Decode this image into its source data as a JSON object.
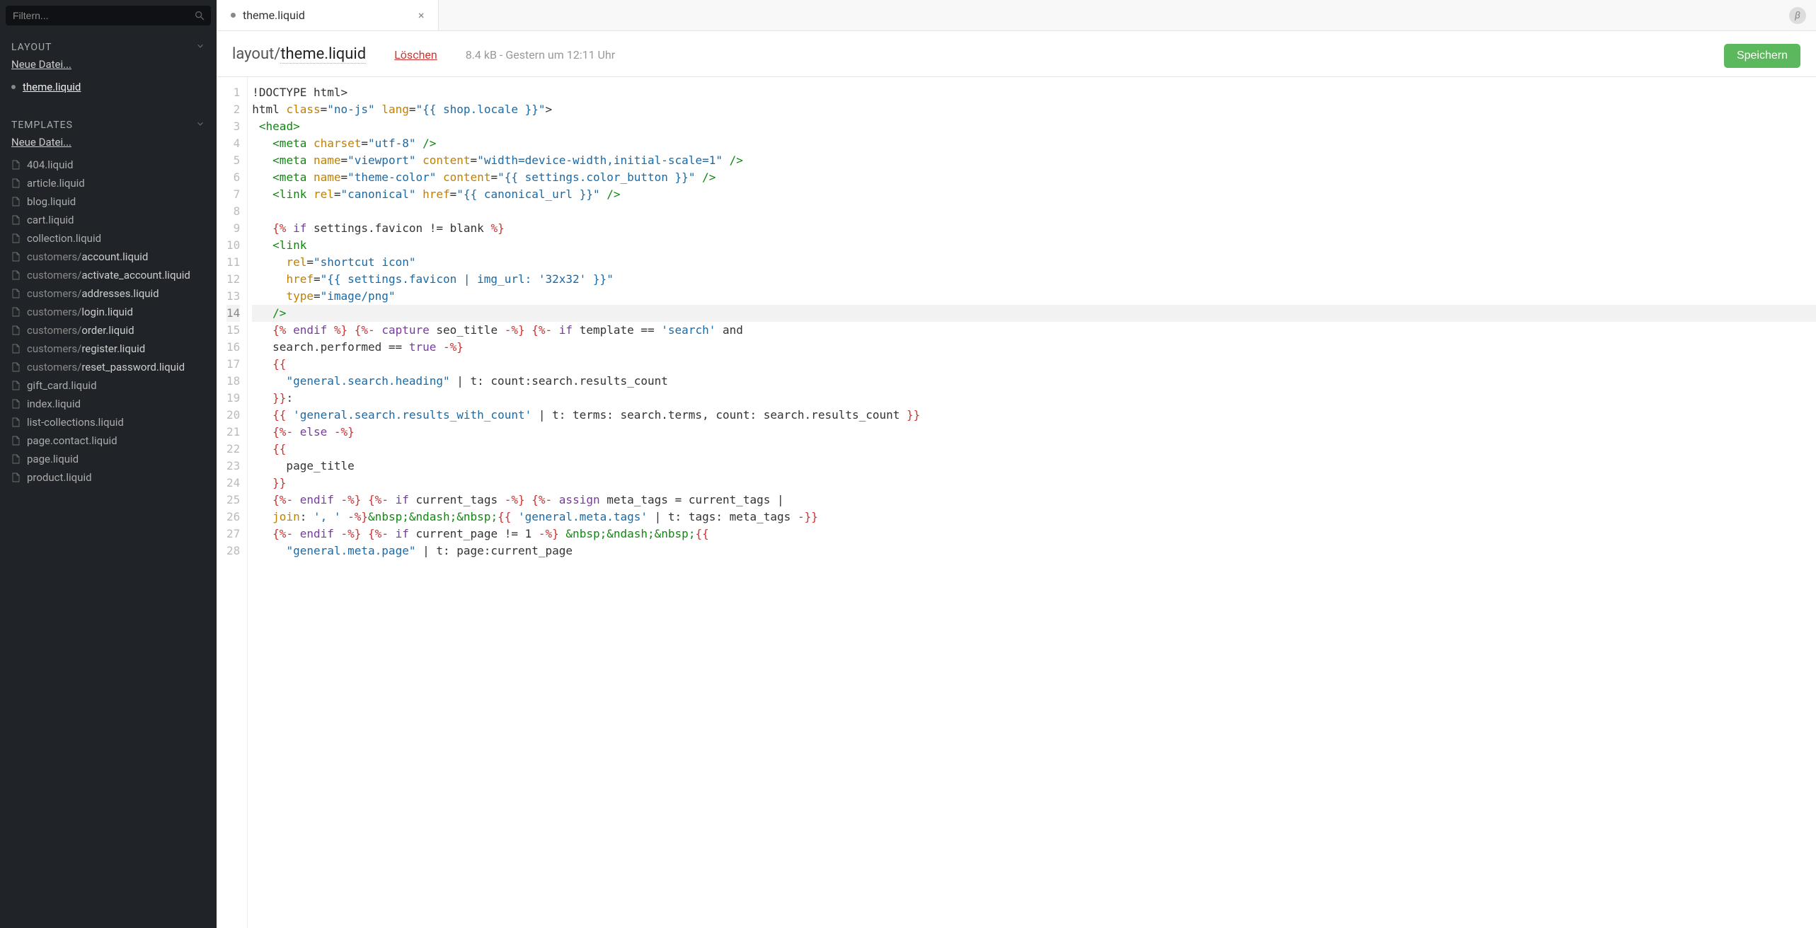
{
  "sidebar": {
    "search_placeholder": "Filtern...",
    "sections": [
      {
        "title": "LAYOUT",
        "new_file_label": "Neue Datei...",
        "items": [
          {
            "label": "theme.liquid",
            "active": true,
            "modified": true
          }
        ]
      },
      {
        "title": "TEMPLATES",
        "new_file_label": "Neue Datei...",
        "items": [
          {
            "label": "404.liquid"
          },
          {
            "label": "article.liquid"
          },
          {
            "label": "blog.liquid"
          },
          {
            "label": "cart.liquid"
          },
          {
            "label": "collection.liquid"
          },
          {
            "prefix": "customers/",
            "label": "account.liquid"
          },
          {
            "prefix": "customers/",
            "label": "activate_account.liquid"
          },
          {
            "prefix": "customers/",
            "label": "addresses.liquid"
          },
          {
            "prefix": "customers/",
            "label": "login.liquid"
          },
          {
            "prefix": "customers/",
            "label": "order.liquid"
          },
          {
            "prefix": "customers/",
            "label": "register.liquid"
          },
          {
            "prefix": "customers/",
            "label": "reset_password.liquid"
          },
          {
            "label": "gift_card.liquid"
          },
          {
            "label": "index.liquid"
          },
          {
            "label": "list-collections.liquid"
          },
          {
            "label": "page.contact.liquid"
          },
          {
            "label": "page.liquid"
          },
          {
            "label": "product.liquid"
          }
        ]
      }
    ]
  },
  "tabs": {
    "active_tab": {
      "label": "theme.liquid",
      "modified": true
    }
  },
  "beta_label": "β",
  "header": {
    "path_prefix": "layout/",
    "path_name": "theme.liquid",
    "delete_label": "Löschen",
    "meta": "8.4 kB - Gestern um 12:11 Uhr",
    "save_label": "Speichern"
  },
  "editor": {
    "highlighted_line": 14,
    "lines": [
      [
        {
          "t": "!DOCTYPE html>",
          "c": "plain"
        }
      ],
      [
        {
          "t": "html ",
          "c": "plain"
        },
        {
          "t": "class",
          "c": "attr"
        },
        {
          "t": "=",
          "c": "plain"
        },
        {
          "t": "\"no-js\"",
          "c": "str"
        },
        {
          "t": " ",
          "c": "plain"
        },
        {
          "t": "lang",
          "c": "attr"
        },
        {
          "t": "=",
          "c": "plain"
        },
        {
          "t": "\"{{ shop.locale }}\"",
          "c": "str"
        },
        {
          "t": ">",
          "c": "plain"
        }
      ],
      [
        {
          "t": " ",
          "c": "plain"
        },
        {
          "t": "<head>",
          "c": "tag"
        }
      ],
      [
        {
          "t": "   ",
          "c": "plain"
        },
        {
          "t": "<meta ",
          "c": "tag"
        },
        {
          "t": "charset",
          "c": "attr"
        },
        {
          "t": "=",
          "c": "plain"
        },
        {
          "t": "\"utf-8\"",
          "c": "str"
        },
        {
          "t": " />",
          "c": "tag"
        }
      ],
      [
        {
          "t": "   ",
          "c": "plain"
        },
        {
          "t": "<meta ",
          "c": "tag"
        },
        {
          "t": "name",
          "c": "attr"
        },
        {
          "t": "=",
          "c": "plain"
        },
        {
          "t": "\"viewport\"",
          "c": "str"
        },
        {
          "t": " ",
          "c": "plain"
        },
        {
          "t": "content",
          "c": "attr"
        },
        {
          "t": "=",
          "c": "plain"
        },
        {
          "t": "\"width=device-width,initial-scale=1\"",
          "c": "str"
        },
        {
          "t": " />",
          "c": "tag"
        }
      ],
      [
        {
          "t": "   ",
          "c": "plain"
        },
        {
          "t": "<meta ",
          "c": "tag"
        },
        {
          "t": "name",
          "c": "attr"
        },
        {
          "t": "=",
          "c": "plain"
        },
        {
          "t": "\"theme-color\"",
          "c": "str"
        },
        {
          "t": " ",
          "c": "plain"
        },
        {
          "t": "content",
          "c": "attr"
        },
        {
          "t": "=",
          "c": "plain"
        },
        {
          "t": "\"{{ settings.color_button }}\"",
          "c": "str"
        },
        {
          "t": " />",
          "c": "tag"
        }
      ],
      [
        {
          "t": "   ",
          "c": "plain"
        },
        {
          "t": "<link ",
          "c": "tag"
        },
        {
          "t": "rel",
          "c": "attr"
        },
        {
          "t": "=",
          "c": "plain"
        },
        {
          "t": "\"canonical\"",
          "c": "str"
        },
        {
          "t": " ",
          "c": "plain"
        },
        {
          "t": "href",
          "c": "attr"
        },
        {
          "t": "=",
          "c": "plain"
        },
        {
          "t": "\"{{ canonical_url }}\"",
          "c": "str"
        },
        {
          "t": " />",
          "c": "tag"
        }
      ],
      [],
      [
        {
          "t": "   ",
          "c": "plain"
        },
        {
          "t": "{% ",
          "c": "liq"
        },
        {
          "t": "if ",
          "c": "kw"
        },
        {
          "t": "settings.favicon != blank ",
          "c": "plain"
        },
        {
          "t": "%}",
          "c": "liq"
        }
      ],
      [
        {
          "t": "   ",
          "c": "plain"
        },
        {
          "t": "<link",
          "c": "tag"
        }
      ],
      [
        {
          "t": "     ",
          "c": "plain"
        },
        {
          "t": "rel",
          "c": "attr"
        },
        {
          "t": "=",
          "c": "plain"
        },
        {
          "t": "\"shortcut icon\"",
          "c": "str"
        }
      ],
      [
        {
          "t": "     ",
          "c": "plain"
        },
        {
          "t": "href",
          "c": "attr"
        },
        {
          "t": "=",
          "c": "plain"
        },
        {
          "t": "\"{{ settings.favicon | img_url: '32x32' }}\"",
          "c": "str"
        }
      ],
      [
        {
          "t": "     ",
          "c": "plain"
        },
        {
          "t": "type",
          "c": "attr"
        },
        {
          "t": "=",
          "c": "plain"
        },
        {
          "t": "\"image/png\"",
          "c": "str"
        }
      ],
      [
        {
          "t": "   ",
          "c": "plain"
        },
        {
          "t": "/>",
          "c": "tag"
        }
      ],
      [
        {
          "t": "   ",
          "c": "plain"
        },
        {
          "t": "{% ",
          "c": "liq"
        },
        {
          "t": "endif ",
          "c": "kw"
        },
        {
          "t": "%}",
          "c": "liq"
        },
        {
          "t": " ",
          "c": "plain"
        },
        {
          "t": "{%- ",
          "c": "liq"
        },
        {
          "t": "capture ",
          "c": "kw"
        },
        {
          "t": "seo_title ",
          "c": "plain"
        },
        {
          "t": "-%}",
          "c": "liq"
        },
        {
          "t": " ",
          "c": "plain"
        },
        {
          "t": "{%- ",
          "c": "liq"
        },
        {
          "t": "if ",
          "c": "kw"
        },
        {
          "t": "template == ",
          "c": "plain"
        },
        {
          "t": "'search'",
          "c": "str"
        },
        {
          "t": " and",
          "c": "plain"
        }
      ],
      [
        {
          "t": "   search.performed == ",
          "c": "plain"
        },
        {
          "t": "true",
          "c": "kw"
        },
        {
          "t": " ",
          "c": "plain"
        },
        {
          "t": "-%}",
          "c": "liq"
        }
      ],
      [
        {
          "t": "   ",
          "c": "plain"
        },
        {
          "t": "{{",
          "c": "liq"
        }
      ],
      [
        {
          "t": "     ",
          "c": "plain"
        },
        {
          "t": "\"general.search.heading\"",
          "c": "str"
        },
        {
          "t": " | t: count:search.results_count",
          "c": "plain"
        }
      ],
      [
        {
          "t": "   ",
          "c": "plain"
        },
        {
          "t": "}}",
          "c": "liq"
        },
        {
          "t": ":",
          "c": "plain"
        }
      ],
      [
        {
          "t": "   ",
          "c": "plain"
        },
        {
          "t": "{{ ",
          "c": "liq"
        },
        {
          "t": "'general.search.results_with_count'",
          "c": "str"
        },
        {
          "t": " | t: terms: search.terms, count: search.results_count ",
          "c": "plain"
        },
        {
          "t": "}}",
          "c": "liq"
        }
      ],
      [
        {
          "t": "   ",
          "c": "plain"
        },
        {
          "t": "{%- ",
          "c": "liq"
        },
        {
          "t": "else ",
          "c": "kw"
        },
        {
          "t": "-%}",
          "c": "liq"
        }
      ],
      [
        {
          "t": "   ",
          "c": "plain"
        },
        {
          "t": "{{",
          "c": "liq"
        }
      ],
      [
        {
          "t": "     page_title",
          "c": "plain"
        }
      ],
      [
        {
          "t": "   ",
          "c": "plain"
        },
        {
          "t": "}}",
          "c": "liq"
        }
      ],
      [
        {
          "t": "   ",
          "c": "plain"
        },
        {
          "t": "{%- ",
          "c": "liq"
        },
        {
          "t": "endif ",
          "c": "kw"
        },
        {
          "t": "-%}",
          "c": "liq"
        },
        {
          "t": " ",
          "c": "plain"
        },
        {
          "t": "{%- ",
          "c": "liq"
        },
        {
          "t": "if ",
          "c": "kw"
        },
        {
          "t": "current_tags ",
          "c": "plain"
        },
        {
          "t": "-%}",
          "c": "liq"
        },
        {
          "t": " ",
          "c": "plain"
        },
        {
          "t": "{%- ",
          "c": "liq"
        },
        {
          "t": "assign ",
          "c": "kw"
        },
        {
          "t": "meta_tags = current_tags |",
          "c": "plain"
        }
      ],
      [
        {
          "t": "   ",
          "c": "plain"
        },
        {
          "t": "join",
          "c": "attr"
        },
        {
          "t": ": ",
          "c": "plain"
        },
        {
          "t": "', '",
          "c": "str"
        },
        {
          "t": " ",
          "c": "plain"
        },
        {
          "t": "-%}",
          "c": "liq"
        },
        {
          "t": "&nbsp;&ndash;&nbsp;",
          "c": "tag"
        },
        {
          "t": "{{ ",
          "c": "liq"
        },
        {
          "t": "'general.meta.tags'",
          "c": "str"
        },
        {
          "t": " | t: tags: meta_tags ",
          "c": "plain"
        },
        {
          "t": "-}}",
          "c": "liq"
        }
      ],
      [
        {
          "t": "   ",
          "c": "plain"
        },
        {
          "t": "{%- ",
          "c": "liq"
        },
        {
          "t": "endif ",
          "c": "kw"
        },
        {
          "t": "-%}",
          "c": "liq"
        },
        {
          "t": " ",
          "c": "plain"
        },
        {
          "t": "{%- ",
          "c": "liq"
        },
        {
          "t": "if ",
          "c": "kw"
        },
        {
          "t": "current_page != 1 ",
          "c": "plain"
        },
        {
          "t": "-%}",
          "c": "liq"
        },
        {
          "t": " ",
          "c": "plain"
        },
        {
          "t": "&nbsp;&ndash;&nbsp;",
          "c": "tag"
        },
        {
          "t": "{{",
          "c": "liq"
        }
      ],
      [
        {
          "t": "     ",
          "c": "plain"
        },
        {
          "t": "\"general.meta.page\"",
          "c": "str"
        },
        {
          "t": " | t: page:current_page",
          "c": "plain"
        }
      ]
    ]
  }
}
